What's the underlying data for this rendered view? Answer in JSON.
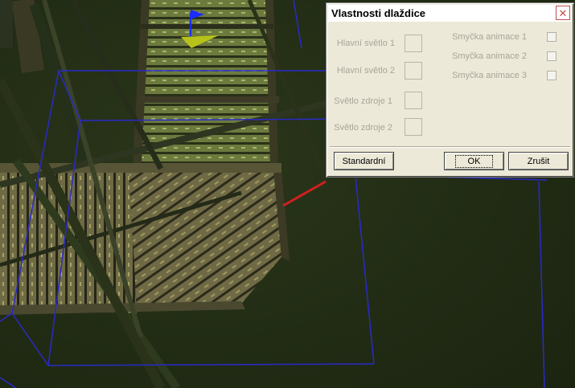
{
  "dialog": {
    "title": "Vlastnosti dlaždice",
    "left_rows": [
      {
        "label": "Hlavní světlo 1"
      },
      {
        "label": "Hlavní světlo 2"
      },
      {
        "label": "Světlo zdroje 1"
      },
      {
        "label": "Světlo zdroje 2"
      }
    ],
    "right_rows": [
      {
        "label": "Smyčka animace 1",
        "checked": false
      },
      {
        "label": "Smyčka animace 2",
        "checked": false
      },
      {
        "label": "Smyčka animace 3",
        "checked": false
      }
    ],
    "buttons": {
      "standard": "Standardní",
      "ok": "OK",
      "cancel": "Zrušit"
    }
  },
  "icons": {
    "close": "close-icon",
    "gizmo": "axis-gizmo-icon"
  },
  "colors": {
    "background": "#1f2a12",
    "selection_wireframe": "#2a2ac8",
    "gizmo_axis_y": "#1a2cff",
    "gizmo_axis_x": "#b7c21a",
    "gizmo_axis_z": "#d02020",
    "dialog_face": "#ece9d8"
  }
}
